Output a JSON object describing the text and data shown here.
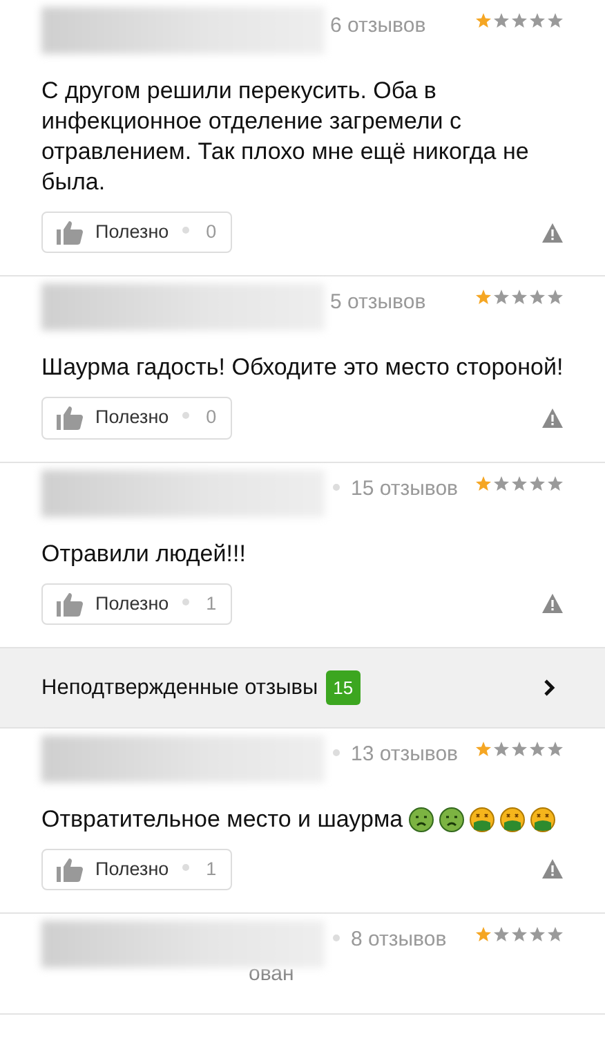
{
  "reviews": [
    {
      "review_count": "6 отзывов",
      "separator": false,
      "stars": 1,
      "text": "С другом решили перекусить. Оба в инфекционное отделение загремели с отравлением. Так плохо мне ещё никогда не была.",
      "helpful_label": "Полезно",
      "helpful_count": "0"
    },
    {
      "review_count": "5 отзывов",
      "separator": false,
      "stars": 1,
      "text": "Шаурма гадость! Обходите это место стороной!",
      "helpful_label": "Полезно",
      "helpful_count": "0"
    },
    {
      "review_count": "15 отзывов",
      "separator": true,
      "stars": 1,
      "text": "Отравили людей!!!",
      "helpful_label": "Полезно",
      "helpful_count": "1"
    }
  ],
  "unconfirmed_banner": {
    "label": "Неподтвержденные отзывы",
    "badge": "15"
  },
  "more_reviews": [
    {
      "review_count": "13 отзывов",
      "separator": true,
      "stars": 1,
      "text": "Отвратительное место и шаурма",
      "reactions": [
        {
          "kind": "nauseated"
        },
        {
          "kind": "nauseated"
        },
        {
          "kind": "vomiting"
        },
        {
          "kind": "vomiting"
        },
        {
          "kind": "vomiting"
        }
      ],
      "helpful_label": "Полезно",
      "helpful_count": "1"
    },
    {
      "review_count": "8 отзывов",
      "separator": true,
      "stars": 1,
      "subtitle_fragment": "ован"
    }
  ]
}
